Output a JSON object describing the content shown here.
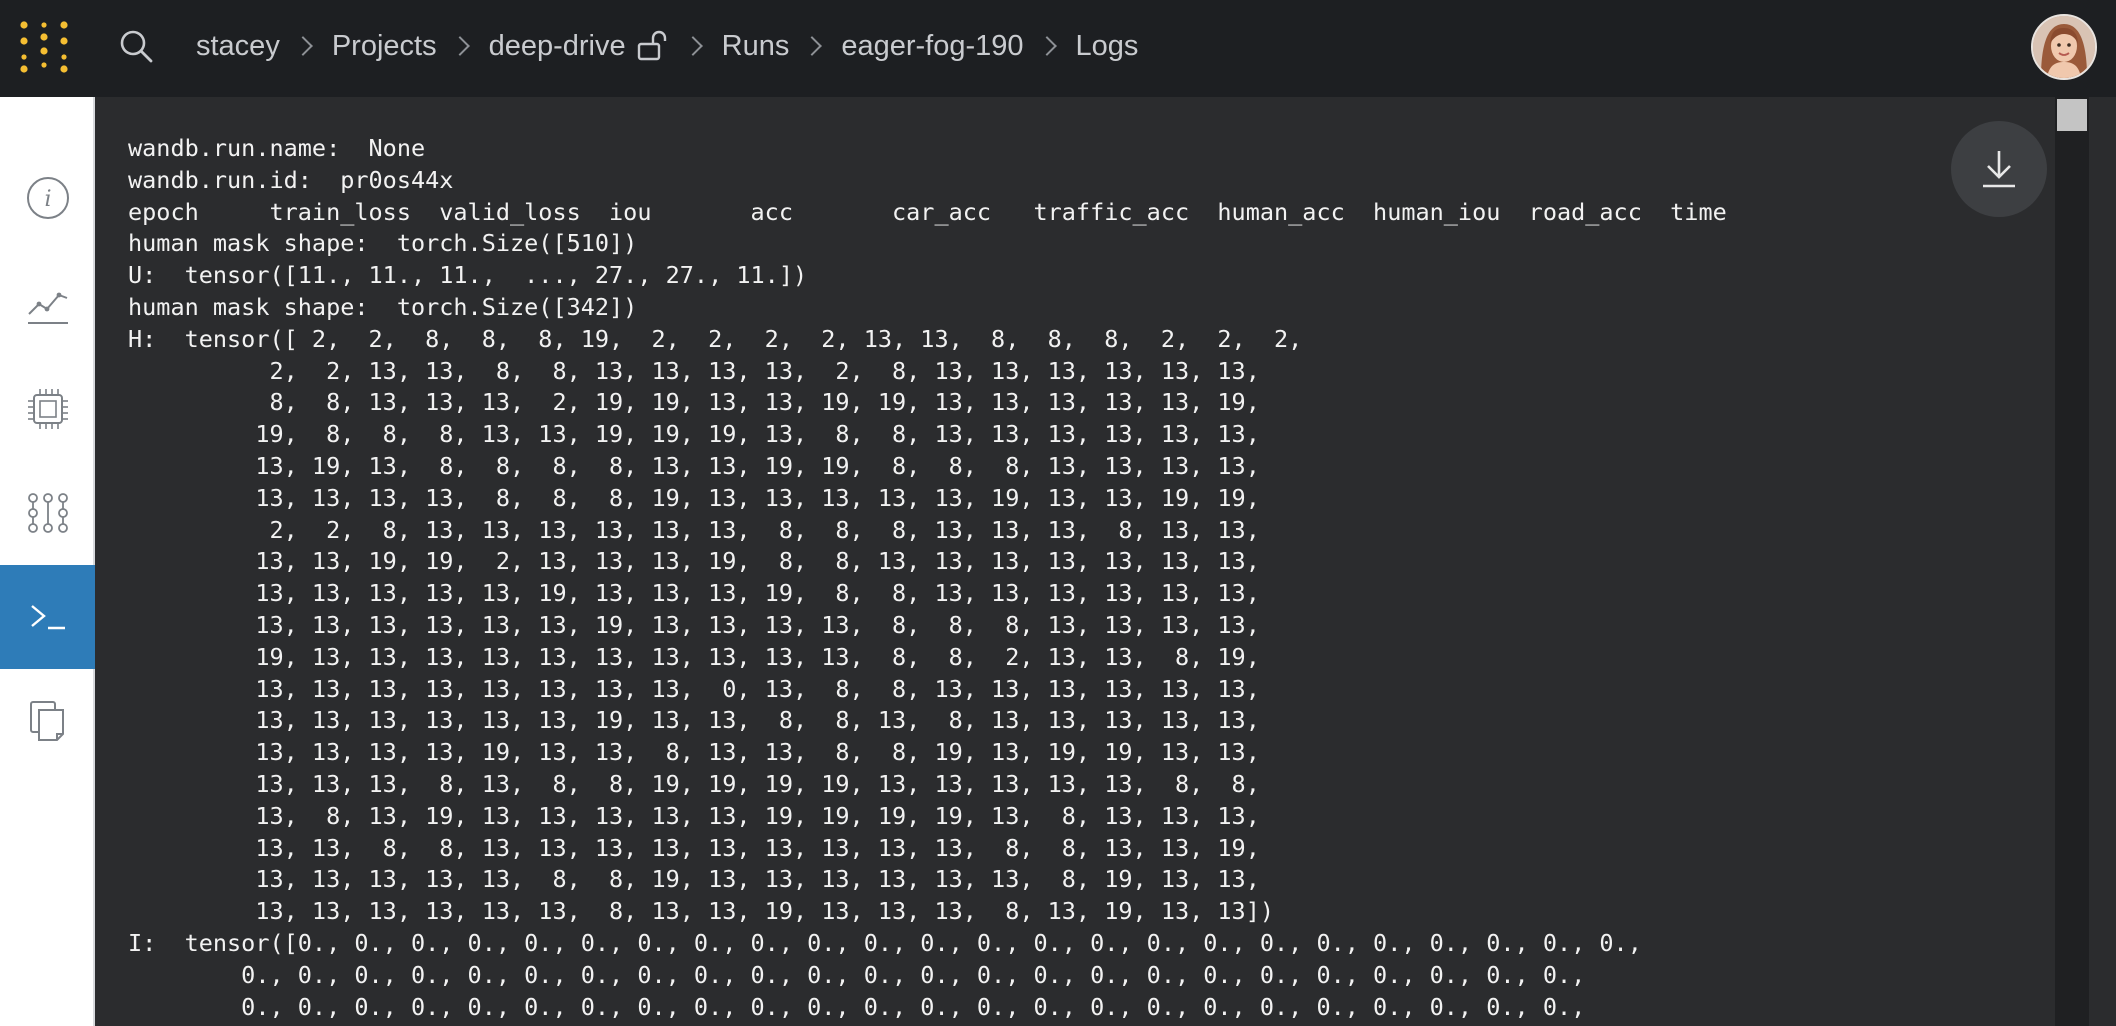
{
  "header": {
    "breadcrumb": [
      {
        "label": "stacey"
      },
      {
        "label": "Projects"
      },
      {
        "label": "deep-drive"
      },
      {
        "label": "Runs"
      },
      {
        "label": "eager-fog-190"
      },
      {
        "label": "Logs"
      }
    ],
    "icons": {
      "logo": "wandb-dots-logo",
      "search": "search-icon",
      "lock": "unlocked-icon",
      "avatar": "user-avatar"
    }
  },
  "sidebar": {
    "items": [
      {
        "icon": "info-icon",
        "active": false
      },
      {
        "icon": "chart-icon",
        "active": false
      },
      {
        "icon": "cpu-icon",
        "active": false
      },
      {
        "icon": "model-graph-icon",
        "active": false
      },
      {
        "icon": "terminal-icon",
        "active": true
      },
      {
        "icon": "files-icon",
        "active": false
      }
    ]
  },
  "colors": {
    "topbar": "#1d1f22",
    "log_background": "#2b2c2e",
    "accent_active": "#2e7cb8",
    "logo_gold": "#f5be32"
  },
  "logs": {
    "text": "wandb.run.name:  None\nwandb.run.id:  pr0os44x\nepoch     train_loss  valid_loss  iou       acc       car_acc   traffic_acc  human_acc  human_iou  road_acc  time\nhuman mask shape:  torch.Size([510])\nU:  tensor([11., 11., 11.,  ..., 27., 27., 11.])\nhuman mask shape:  torch.Size([342])\nH:  tensor([ 2,  2,  8,  8,  8, 19,  2,  2,  2,  2, 13, 13,  8,  8,  8,  2,  2,  2,\n          2,  2, 13, 13,  8,  8, 13, 13, 13, 13,  2,  8, 13, 13, 13, 13, 13, 13,\n          8,  8, 13, 13, 13,  2, 19, 19, 13, 13, 19, 19, 13, 13, 13, 13, 13, 19,\n         19,  8,  8,  8, 13, 13, 19, 19, 19, 13,  8,  8, 13, 13, 13, 13, 13, 13,\n         13, 19, 13,  8,  8,  8,  8, 13, 13, 19, 19,  8,  8,  8, 13, 13, 13, 13,\n         13, 13, 13, 13,  8,  8,  8, 19, 13, 13, 13, 13, 13, 19, 13, 13, 19, 19,\n          2,  2,  8, 13, 13, 13, 13, 13, 13,  8,  8,  8, 13, 13, 13,  8, 13, 13,\n         13, 13, 19, 19,  2, 13, 13, 13, 19,  8,  8, 13, 13, 13, 13, 13, 13, 13,\n         13, 13, 13, 13, 13, 19, 13, 13, 13, 19,  8,  8, 13, 13, 13, 13, 13, 13,\n         13, 13, 13, 13, 13, 13, 19, 13, 13, 13, 13,  8,  8,  8, 13, 13, 13, 13,\n         19, 13, 13, 13, 13, 13, 13, 13, 13, 13, 13,  8,  8,  2, 13, 13,  8, 19,\n         13, 13, 13, 13, 13, 13, 13, 13,  0, 13,  8,  8, 13, 13, 13, 13, 13, 13,\n         13, 13, 13, 13, 13, 13, 19, 13, 13,  8,  8, 13,  8, 13, 13, 13, 13, 13,\n         13, 13, 13, 13, 19, 13, 13,  8, 13, 13,  8,  8, 19, 13, 19, 19, 13, 13,\n         13, 13, 13,  8, 13,  8,  8, 19, 19, 19, 19, 13, 13, 13, 13, 13,  8,  8,\n         13,  8, 13, 19, 13, 13, 13, 13, 13, 19, 19, 19, 19, 13,  8, 13, 13, 13,\n         13, 13,  8,  8, 13, 13, 13, 13, 13, 13, 13, 13, 13,  8,  8, 13, 13, 19,\n         13, 13, 13, 13, 13,  8,  8, 19, 13, 13, 13, 13, 13, 13,  8, 19, 13, 13,\n         13, 13, 13, 13, 13, 13,  8, 13, 13, 19, 13, 13, 13,  8, 13, 19, 13, 13])\nI:  tensor([0., 0., 0., 0., 0., 0., 0., 0., 0., 0., 0., 0., 0., 0., 0., 0., 0., 0., 0., 0., 0., 0., 0., 0.,\n        0., 0., 0., 0., 0., 0., 0., 0., 0., 0., 0., 0., 0., 0., 0., 0., 0., 0., 0., 0., 0., 0., 0., 0.,\n        0., 0., 0., 0., 0., 0., 0., 0., 0., 0., 0., 0., 0., 0., 0., 0., 0., 0., 0., 0., 0., 0., 0., 0.,"
  },
  "download": {
    "icon": "download-icon"
  }
}
